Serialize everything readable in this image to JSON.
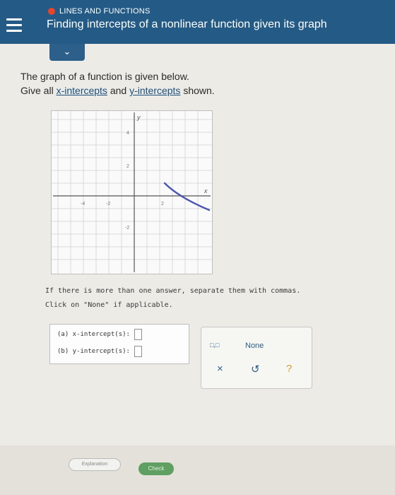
{
  "header": {
    "topic": "LINES AND FUNCTIONS",
    "title": "Finding intercepts of a nonlinear function given its graph"
  },
  "prompt": {
    "line1": "The graph of a function is given below.",
    "line2_prefix": "Give all ",
    "x_link": "x-intercepts",
    "line2_mid": " and ",
    "y_link": "y-intercepts",
    "line2_suffix": " shown."
  },
  "graph": {
    "x_axis_label": "x",
    "y_axis_label": "y",
    "x_ticks": [
      "-4",
      "-2",
      "2"
    ],
    "y_ticks": [
      "4",
      "2",
      "-2"
    ]
  },
  "instructions": {
    "line1": "If there is more than one answer, separate them with commas.",
    "line2": "Click on \"None\" if applicable."
  },
  "answers": {
    "a_label": "(a)  x-intercept(s):",
    "b_label": "(b)  y-intercept(s):",
    "a_value": "",
    "b_value": ""
  },
  "tools": {
    "none_label": "None",
    "clear_symbol": "×",
    "undo_symbol": "↺",
    "help_symbol": "?"
  },
  "footer": {
    "explanation_label": "Explanation",
    "check_label": "Check"
  },
  "colors": {
    "header_bg": "#245b86",
    "curve": "#4a55b0",
    "topic_dot": "#e8452c",
    "check_bg": "#5fa062"
  }
}
